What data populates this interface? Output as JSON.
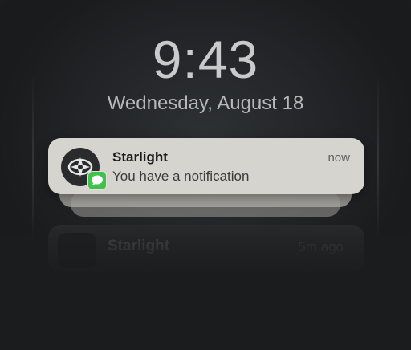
{
  "lockscreen": {
    "time": "9:43",
    "date": "Wednesday, August 18"
  },
  "notification": {
    "app_name": "Starlight",
    "message": "You have a notification",
    "time": "now",
    "app_icon": "starlight-logo-icon",
    "badge_icon": "messages-icon",
    "badge_color": "#3ec24b"
  },
  "faded_notification": {
    "app_name": "Starlight",
    "time": "5m ago"
  }
}
